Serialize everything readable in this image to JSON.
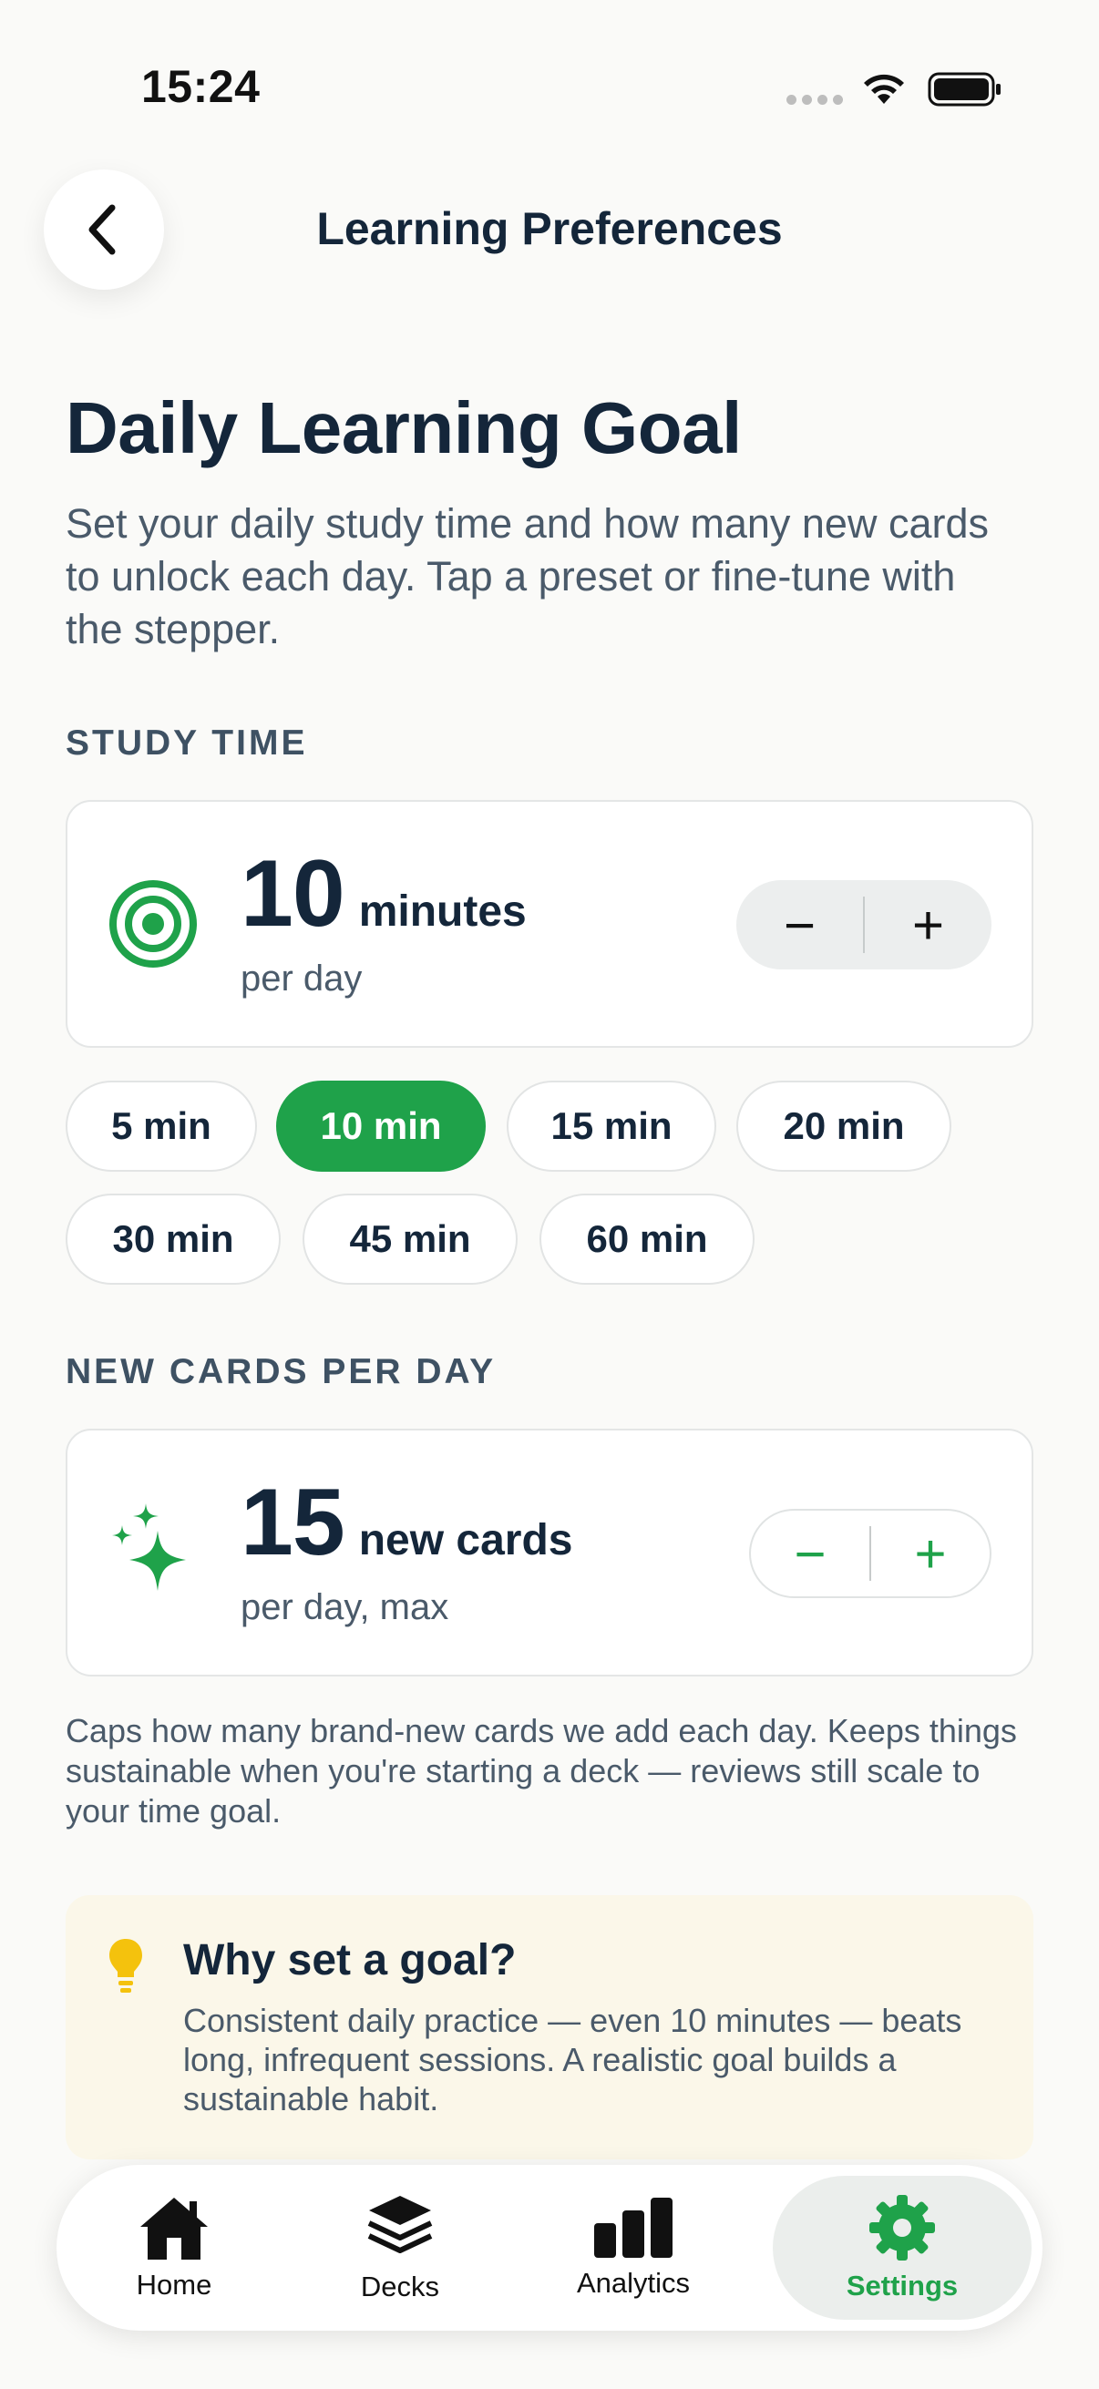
{
  "status_bar": {
    "time": "15:24"
  },
  "header": {
    "title": "Learning Preferences"
  },
  "page": {
    "title": "Daily Learning Goal",
    "description": "Set your daily study time and how many new cards to unlock each day. Tap a preset or fine-tune with the stepper."
  },
  "study_time": {
    "section_label": "STUDY TIME",
    "value": "10",
    "unit": "minutes",
    "sub": "per day",
    "minus": "−",
    "plus": "+",
    "presets": [
      "5 min",
      "10 min",
      "15 min",
      "20 min",
      "30 min",
      "45 min",
      "60 min"
    ],
    "selected": "10 min"
  },
  "new_cards": {
    "section_label": "NEW CARDS PER DAY",
    "value": "15",
    "unit": "new cards",
    "sub": "per day, max",
    "minus": "−",
    "plus": "+",
    "note": "Caps how many brand-new cards we add each day. Keeps things sustainable when you're starting a deck — reviews still scale to your time goal."
  },
  "tip": {
    "title": "Why set a goal?",
    "body": "Consistent daily practice — even 10 minutes — beats long, infrequent sessions. A realistic goal builds a sustainable habit."
  },
  "tabbar": {
    "home": "Home",
    "decks": "Decks",
    "analytics": "Analytics",
    "settings": "Settings",
    "active": "Settings"
  },
  "colors": {
    "accent": "#1fa24a",
    "text": "#14263a",
    "muted": "#4a5a6a",
    "tip_bg": "#fbf7e9",
    "bulb": "#f4c20d"
  }
}
